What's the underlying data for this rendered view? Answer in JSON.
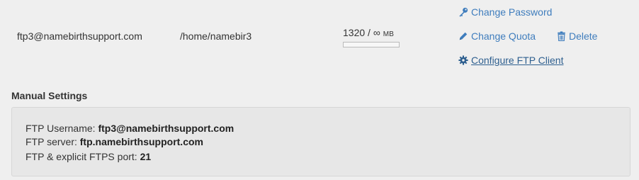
{
  "account": {
    "username": "ftp3@namebirthsupport.com",
    "directory": "/home/namebir3",
    "usage": "1320",
    "separator": "/",
    "quota": "∞",
    "unit": "MB",
    "usage_fraction": 0
  },
  "actions": {
    "change_password": "Change Password",
    "change_quota": "Change Quota",
    "delete": "Delete",
    "configure_ftp_client": "Configure FTP Client"
  },
  "manual_settings": {
    "title": "Manual Settings",
    "username_label": "FTP Username:",
    "username_value": "ftp3@namebirthsupport.com",
    "server_label": "FTP server:",
    "server_value": "ftp.namebirthsupport.com",
    "port_label": "FTP & explicit FTPS port:",
    "port_value": "21"
  },
  "colors": {
    "link": "#3f7dbd",
    "link_dark": "#2e5f8f",
    "background": "#efefef",
    "panel": "#e7e7e7"
  },
  "icons": [
    "key-icon",
    "pencil-icon",
    "trash-icon",
    "gear-icon"
  ]
}
